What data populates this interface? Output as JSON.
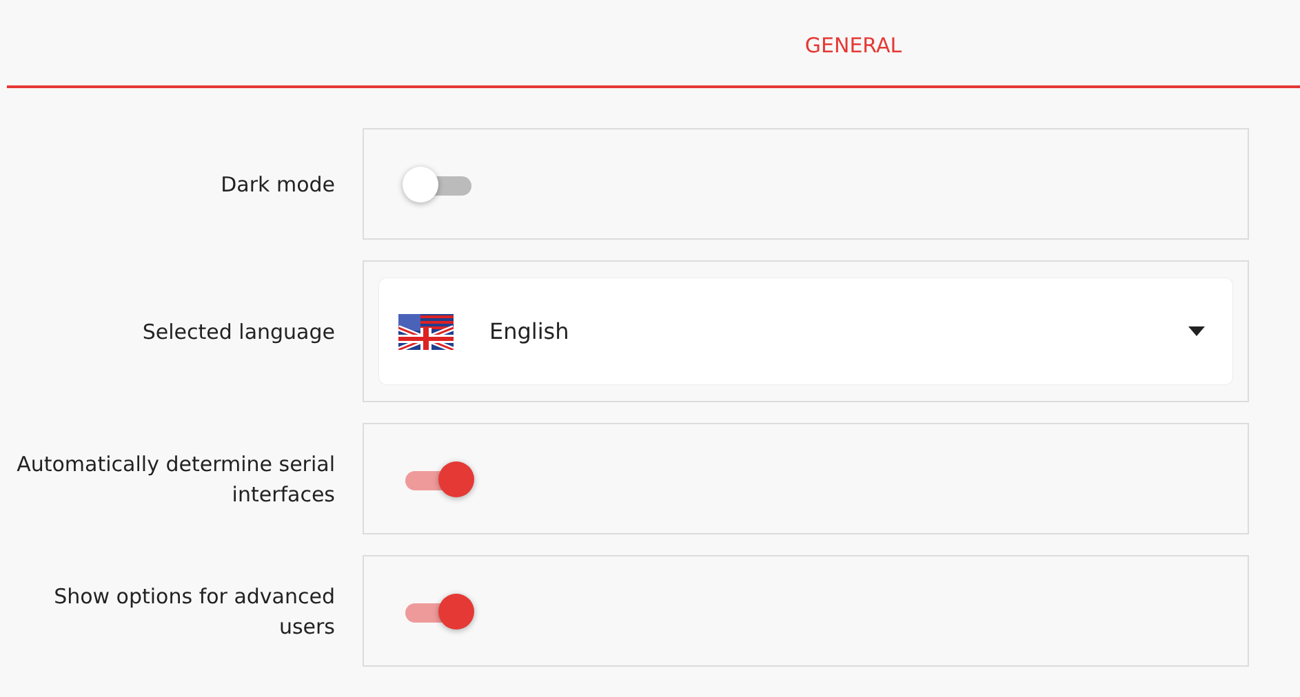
{
  "tabs": [
    {
      "label": "GENERAL",
      "selected": true
    }
  ],
  "settings": [
    {
      "kind": "toggle",
      "label": "Dark mode",
      "on": false
    },
    {
      "kind": "select",
      "label": "Selected language",
      "value": "English"
    },
    {
      "kind": "toggle",
      "label": "Automatically determine serial interfaces",
      "on": true
    },
    {
      "kind": "toggle",
      "label": "Show options for advanced users",
      "on": true
    }
  ]
}
